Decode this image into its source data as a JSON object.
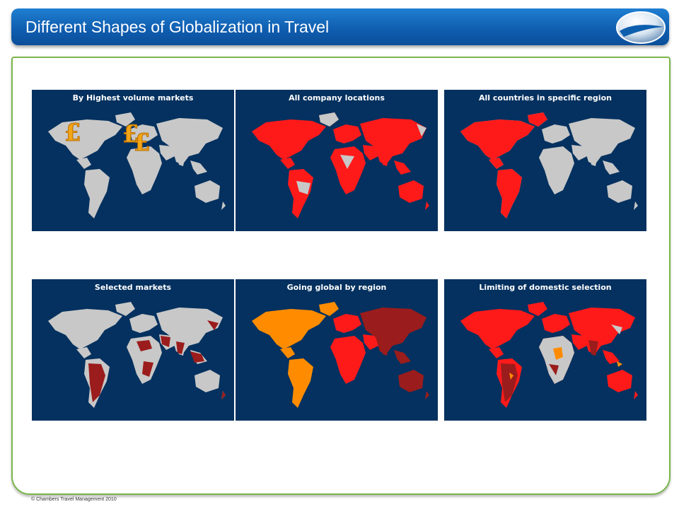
{
  "slide": {
    "title": "Different Shapes of Globalization in Travel",
    "footer": "© Chambers Travel Management 2010"
  },
  "colors": {
    "panel_bg": "#04315f",
    "land_default": "#c8c8c8",
    "red": "#ff1a1a",
    "dark_red": "#9b1c1c",
    "orange": "#ff8c00",
    "title_blue": "#0f5cae",
    "frame_green": "#7ab64a"
  },
  "panels": [
    {
      "title": "By Highest volume markets",
      "icon": "pound-sign-icon",
      "pound_glyph": "£"
    },
    {
      "title": "All company locations"
    },
    {
      "title": "All countries in specific region"
    },
    {
      "title": "Selected markets"
    },
    {
      "title": "Going global by region"
    },
    {
      "title": "Limiting of domestic selection"
    }
  ]
}
